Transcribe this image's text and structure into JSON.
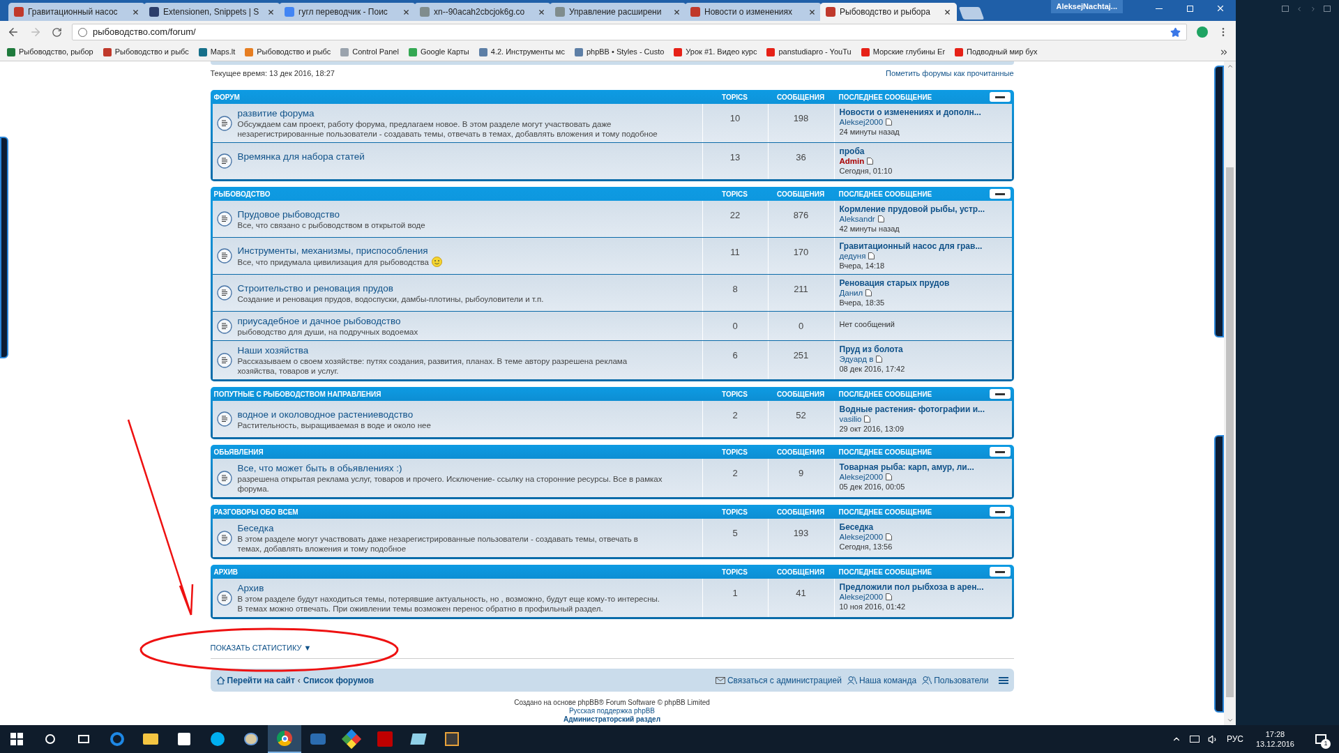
{
  "browser": {
    "tabs": [
      {
        "title": "Гравитационный насос",
        "selected": false,
        "color": "#c0392b"
      },
      {
        "title": "Extensionen, Snippets | S",
        "selected": false,
        "color": "#2c3e6b"
      },
      {
        "title": "гугл переводчик - Поис",
        "selected": false,
        "color": "#4285f4"
      },
      {
        "title": "xn--90acah2cbcjok6g.co",
        "selected": false,
        "color": "#7f8c8d"
      },
      {
        "title": "Управление расширени",
        "selected": false,
        "color": "#7f8c8d"
      },
      {
        "title": "Новости о изменениях",
        "selected": false,
        "color": "#c0392b"
      },
      {
        "title": "Рыбоводство и рыбора",
        "selected": true,
        "color": "#c0392b"
      }
    ],
    "user": "AleksejNachtaj...",
    "address": "рыбоводство.com/forum/",
    "bookmarks": [
      {
        "title": "Рыбоводство, рыбор",
        "color": "#1e7a3c"
      },
      {
        "title": "Рыбоводство и рыбс",
        "color": "#c0392b"
      },
      {
        "title": "Maps.lt",
        "color": "#16708a"
      },
      {
        "title": "Рыбоводство и рыбс",
        "color": "#e67e22"
      },
      {
        "title": "Control Panel",
        "color": "#9aa3ad"
      },
      {
        "title": "Google Карты",
        "color": "#34a853"
      },
      {
        "title": "4.2. Инструменты мс",
        "color": "#5d7fa6"
      },
      {
        "title": "phpBB • Styles - Custo",
        "color": "#5d7fa6"
      },
      {
        "title": "Урок #1. Видео курс",
        "color": "#e62117"
      },
      {
        "title": "panstudiapro - YouTu",
        "color": "#e62117"
      },
      {
        "title": "Морские глубины Er",
        "color": "#e62117"
      },
      {
        "title": "Подводный мир бух",
        "color": "#e62117"
      }
    ]
  },
  "page": {
    "current_time": "Текущее время: 13 дек 2016, 18:27",
    "mark_read": "Пометить форумы как прочитанные",
    "categories": [
      {
        "title": "ФОРУМ",
        "columns": [
          "TOPICS",
          "СООБЩЕНИЯ",
          "ПОСЛЕДНЕЕ СООБЩЕНИЕ"
        ],
        "forums": [
          {
            "title": "развитие форума",
            "description": "Обсуждаем сам проект, работу форума, предлагаем новое. В этом разделе могут участвовать даже незарегистрированные пользователи - создавать темы, отвечать в темах, добавлять вложения и тому подобное",
            "smiley": false,
            "topics": "10",
            "posts": "198",
            "last_post": {
              "kind": "post",
              "title": "Новости о изменениях и дополн...",
              "author": "Aleksej2000",
              "color": "#105289",
              "time": "24 минуты назад"
            }
          },
          {
            "title": "Времянка для набора статей",
            "smiley": false,
            "topics": "13",
            "posts": "36",
            "last_post": {
              "kind": "post",
              "title": "проба",
              "author": "Admin",
              "color": "#aa0000",
              "time": "Сегодня, 01:10"
            }
          }
        ]
      },
      {
        "title": "РЫБОВОДСТВО",
        "columns": [
          "TOPICS",
          "СООБЩЕНИЯ",
          "ПОСЛЕДНЕЕ СООБЩЕНИЕ"
        ],
        "forums": [
          {
            "title": "Прудовое рыбоводство",
            "description": "Все, что связано с рыбоводством в открытой воде",
            "smiley": false,
            "topics": "22",
            "posts": "876",
            "last_post": {
              "kind": "post",
              "title": "Кормление прудовой рыбы, устр...",
              "author": "Aleksandr",
              "color": "#105289",
              "time": "42 минуты назад"
            }
          },
          {
            "title": "Инструменты, механизмы, приспособления",
            "description": "Все, что придумала цивилизация для рыбоводства",
            "smiley": true,
            "topics": "11",
            "posts": "170",
            "last_post": {
              "kind": "post",
              "title": "Гравитационный насос для грав...",
              "author": "дедуня",
              "color": "#105289",
              "time": "Вчера, 14:18"
            }
          },
          {
            "title": "Строительство и реновация прудов",
            "description": "Создание и реновация прудов, водоспуски, дамбы-плотины, рыбоуловители и т.п.",
            "smiley": false,
            "topics": "8",
            "posts": "211",
            "last_post": {
              "kind": "post",
              "title": "Реновация старых прудов",
              "author": "Данил",
              "color": "#105289",
              "time": "Вчера, 18:35"
            }
          },
          {
            "title": "приусадебное и дачное рыбоводство",
            "description": "рыбоводство для души, на подручных водоемах",
            "smiley": false,
            "topics": "0",
            "posts": "0",
            "last_post": {
              "kind": "none",
              "text": "Нет сообщений"
            }
          },
          {
            "title": "Наши хозяйства",
            "description": "Рассказываем о своем хозяйстве: путях создания, развития, планах. В теме автору разрешена реклама хозяйства, товаров и услуг.",
            "smiley": false,
            "topics": "6",
            "posts": "251",
            "last_post": {
              "kind": "post",
              "title": "Пруд из болота",
              "author": "Эдуард в",
              "color": "#105289",
              "time": "08 дек 2016, 17:42"
            }
          }
        ]
      },
      {
        "title": "ПОПУТНЫЕ С РЫБОВОДСТВОМ НАПРАВЛЕНИЯ",
        "columns": [
          "TOPICS",
          "СООБЩЕНИЯ",
          "ПОСЛЕДНЕЕ СООБЩЕНИЕ"
        ],
        "forums": [
          {
            "title": "водное и околоводное растениеводство",
            "description": "Растительность, выращиваемая в воде и около нее",
            "smiley": false,
            "topics": "2",
            "posts": "52",
            "last_post": {
              "kind": "post",
              "title": "Водные растения- фотографии и...",
              "author": "vasilio",
              "color": "#105289",
              "time": "29 окт 2016, 13:09"
            }
          }
        ]
      },
      {
        "title": "ОБЬЯВЛЕНИЯ",
        "columns": [
          "TOPICS",
          "СООБЩЕНИЯ",
          "ПОСЛЕДНЕЕ СООБЩЕНИЕ"
        ],
        "forums": [
          {
            "title": "Все, что может быть в обьявлениях :)",
            "description": "разрешена открытая реклама услуг, товаров и прочего. Исключение- ссылку на сторонние ресурсы. Все в рамках форума.",
            "smiley": false,
            "topics": "2",
            "posts": "9",
            "last_post": {
              "kind": "post",
              "title": "Товарная рыба: карп, амур, ли...",
              "author": "Aleksej2000",
              "color": "#105289",
              "time": "05 дек 2016, 00:05"
            }
          }
        ]
      },
      {
        "title": "РАЗГОВОРЫ ОБО ВСЕМ",
        "columns": [
          "TOPICS",
          "СООБЩЕНИЯ",
          "ПОСЛЕДНЕЕ СООБЩЕНИЕ"
        ],
        "forums": [
          {
            "title": "Беседка",
            "description": "В этом разделе могут участвовать даже незарегистрированные пользователи - создавать темы, отвечать в темах, добавлять вложения и тому подобное",
            "smiley": false,
            "topics": "5",
            "posts": "193",
            "last_post": {
              "kind": "post",
              "title": "Беседка",
              "author": "Aleksej2000",
              "color": "#105289",
              "time": "Сегодня, 13:56"
            }
          }
        ]
      },
      {
        "title": "АРХИВ",
        "columns": [
          "TOPICS",
          "СООБЩЕНИЯ",
          "ПОСЛЕДНЕЕ СООБЩЕНИЕ"
        ],
        "forums": [
          {
            "title": "Архив",
            "description": "В этом разделе будут находиться темы, потерявшие актуальность, но , возможно, будут еще кому-то интересны. В темах можно отвечать. При оживлении темы возможен перенос обратно в профильный раздел.",
            "smiley": false,
            "topics": "1",
            "posts": "41",
            "last_post": {
              "kind": "post",
              "title": "Предложили пол рыбхоза в арен...",
              "author": "Aleksej2000",
              "color": "#105289",
              "time": "10 ноя 2016, 01:42"
            }
          }
        ]
      }
    ],
    "stats_toggle": "ПОКАЗАТЬ СТАТИСТИКУ ▼",
    "nav": {
      "home": "Перейти на сайт",
      "separator": "‹",
      "index": "Список форумов",
      "links": [
        "Связаться с администрацией",
        "Наша команда",
        "Пользователи"
      ]
    },
    "credits": [
      "Создано на основе phpBB® Forum Software © phpBB Limited",
      "Русская поддержка phpBB",
      "Администраторский раздел"
    ]
  },
  "taskbar": {
    "language": "РУС",
    "time": "17:28",
    "date": "13.12.2016",
    "notifications": "1"
  }
}
